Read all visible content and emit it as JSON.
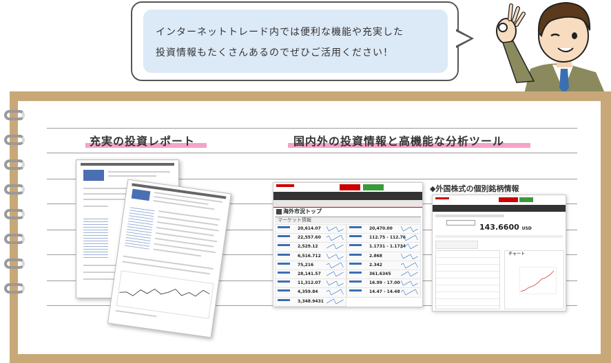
{
  "bubble": {
    "line1": "インターネットトレード内では便利な機能や充実した",
    "line2": "投資情報もたくさんあるのでぜひご活用ください！"
  },
  "sections": {
    "report_heading": "充実の投資レポート",
    "tools_heading": "国内外の投資情報と高機能な分析ツール",
    "stock_heading": "◆外国株式の個別銘柄情報"
  },
  "market_screen": {
    "title": "海外市況トップ",
    "panel": "マーケット情報",
    "left_values": [
      "20,614.07",
      "22,557.60",
      "2,529.12",
      "6,516.712",
      "75,216",
      "28,141.57",
      "11,312.07",
      "4,359.84",
      "3,348.9431"
    ],
    "right_values": [
      "20,470.00",
      "112.75 - 112.76",
      "1.1731 - 1.1734",
      "2.868",
      "2.342",
      "361.6345",
      "16.99 - 17.00",
      "14.47 - 14.48"
    ]
  },
  "stock_screen": {
    "price": "143.6600",
    "currency": "USD",
    "chart_label": "チャート"
  },
  "colors": {
    "frame": "#c8a878",
    "highlight": "#f5a3c7",
    "bubble": "#dce9f7",
    "brand_red": "#cc0000"
  }
}
